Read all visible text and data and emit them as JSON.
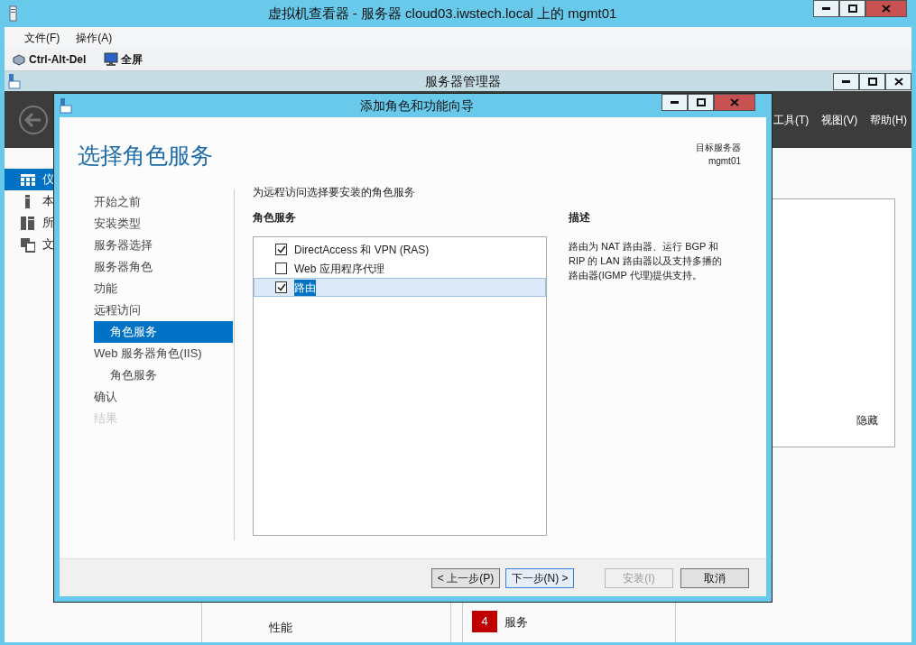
{
  "viewer": {
    "title": "虚拟机查看器 - 服务器 cloud03.iwstech.local 上的 mgmt01",
    "menu": [
      {
        "label": "文件(F)"
      },
      {
        "label": "操作(A)"
      }
    ],
    "toolbar": [
      {
        "label": "Ctrl-Alt-Del"
      },
      {
        "label": "全屏"
      }
    ]
  },
  "server_manager": {
    "title": "服务器管理器",
    "menu": [
      {
        "label": "工具(T)"
      },
      {
        "label": "视图(V)"
      },
      {
        "label": "帮助(H)"
      }
    ],
    "sidebar": [
      {
        "label": "仪",
        "selected": true
      },
      {
        "label": "本",
        "selected": false
      },
      {
        "label": "所",
        "selected": false
      },
      {
        "label": "文",
        "selected": false
      }
    ],
    "panel_link": "隐藏",
    "tiles": [
      {
        "label": "性能"
      },
      {
        "label": "服务",
        "count": "4"
      }
    ]
  },
  "wizard": {
    "title": "添加角色和功能向导",
    "heading": "选择角色服务",
    "target_label": "目标服务器",
    "target_value": "mgmt01",
    "steps": [
      {
        "label": "开始之前",
        "selected": false,
        "disabled": false
      },
      {
        "label": "安装类型",
        "selected": false,
        "disabled": false
      },
      {
        "label": "服务器选择",
        "selected": false,
        "disabled": false
      },
      {
        "label": "服务器角色",
        "selected": false,
        "disabled": false
      },
      {
        "label": "功能",
        "selected": false,
        "disabled": false
      },
      {
        "label": "远程访问",
        "selected": false,
        "disabled": false,
        "children": [
          {
            "label": "角色服务",
            "selected": true,
            "disabled": false
          }
        ]
      },
      {
        "label": "Web 服务器角色(IIS)",
        "selected": false,
        "disabled": false,
        "children": [
          {
            "label": "角色服务",
            "selected": false,
            "disabled": false
          }
        ]
      },
      {
        "label": "确认",
        "selected": false,
        "disabled": false
      },
      {
        "label": "结果",
        "selected": false,
        "disabled": true
      }
    ],
    "instruction": "为远程访问选择要安装的角色服务",
    "list_title": "角色服务",
    "services": [
      {
        "label": "DirectAccess 和 VPN (RAS)",
        "checked": true,
        "selected": false
      },
      {
        "label": "Web 应用程序代理",
        "checked": false,
        "selected": false
      },
      {
        "label": "路由",
        "checked": true,
        "selected": true
      }
    ],
    "description_title": "描述",
    "description": "路由为 NAT 路由器、运行 BGP 和 RIP 的 LAN 路由器以及支持多播的路由器(IGMP 代理)提供支持。",
    "buttons": [
      {
        "label": "< 上一步(P)",
        "disabled": false,
        "focused": false
      },
      {
        "label": "下一步(N) >",
        "disabled": false,
        "focused": true
      },
      {
        "label": "安装(I)",
        "disabled": true,
        "focused": false
      },
      {
        "label": "取消",
        "disabled": false,
        "focused": false
      }
    ]
  }
}
